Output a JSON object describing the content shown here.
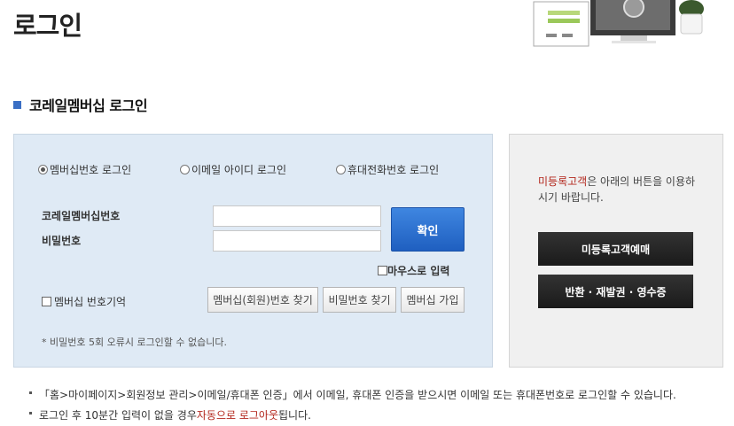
{
  "page_title": "로그인",
  "section_title": "코레일멤버십 로그인",
  "login_types": [
    {
      "label": "멤버십번호 로그인",
      "selected": true
    },
    {
      "label": "이메일 아이디 로그인",
      "selected": false
    },
    {
      "label": "휴대전화번호 로그인",
      "selected": false
    }
  ],
  "form": {
    "member_number_label": "코레일멤버십번호",
    "password_label": "비밀번호",
    "member_number_value": "",
    "password_value": "",
    "confirm_label": "확인",
    "mouse_input_label": "마우스로 입력",
    "remember_label": "멤버십 번호기억",
    "find_member_label": "멤버십(회원)번호 찾기",
    "find_password_label": "비밀번호 찾기",
    "join_label": "멤버십 가입",
    "note": "* 비밀번호 5회 오류시 로그인할 수 없습니다."
  },
  "side": {
    "highlight": "미등록고객",
    "text": "은 아래의 버튼을 이용하시기 바랍니다.",
    "unregistered_button": "미등록고객예매",
    "refund_button": "반환 · 재발권 · 영수증"
  },
  "notices": {
    "first": "「홈>마이페이지>회원정보 관리>이메일/휴대폰 인증」에서 이메일, 휴대폰 인증을 받으시면 이메일 또는 휴대폰번호로 로그인할 수 있습니다.",
    "second_before": "로그인 후 10분간 입력이 없을 경우 ",
    "second_highlight": "자동으로 로그아웃",
    "second_after": " 됩니다."
  },
  "colors": {
    "accent": "#3a6fc4",
    "login_bg": "#dfeaf5",
    "highlight_red": "#b3271d",
    "confirm_blue": "#1f5fc0"
  }
}
